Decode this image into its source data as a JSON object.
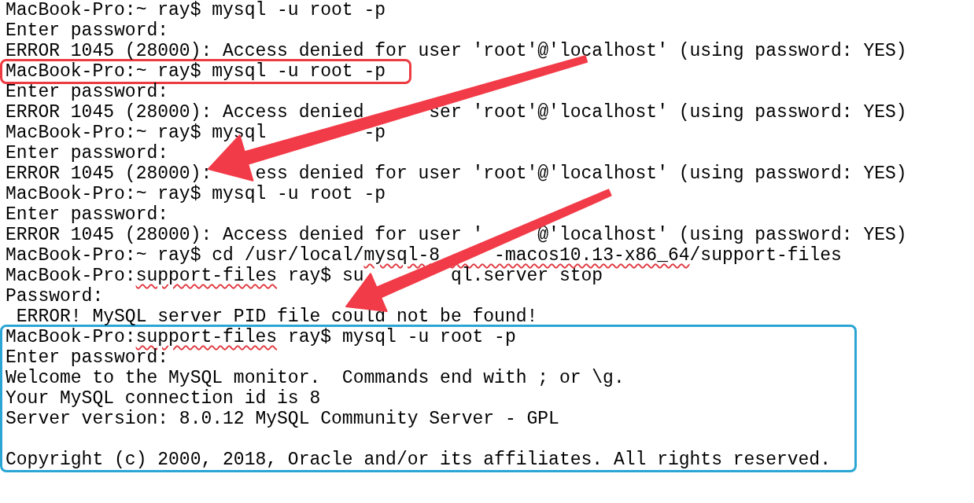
{
  "blocks": [
    {
      "framed": false,
      "lines": [
        {
          "kind": "text",
          "segments": [
            {
              "text": "MacBook-Pro:~ ray$ mysql -u root -p",
              "misspelled": false
            }
          ]
        },
        {
          "kind": "text",
          "segments": [
            {
              "text": "Enter password:",
              "misspelled": false
            }
          ]
        },
        {
          "kind": "text",
          "segments": [
            {
              "text": "ERROR 1045 (28000): Access denied for user 'root'@'localhost' (using password: YES)",
              "misspelled": false
            }
          ]
        }
      ]
    },
    {
      "framed": true,
      "color": "#ec3b41",
      "lines": [
        {
          "kind": "text",
          "segments": [
            {
              "text": "MacBook-Pro:~ ray$ mysql -u root -p",
              "misspelled": false
            }
          ]
        }
      ]
    },
    {
      "framed": false,
      "lines": [
        {
          "kind": "text",
          "segments": [
            {
              "text": "Enter password:",
              "misspelled": false
            }
          ]
        },
        {
          "kind": "text",
          "segments": [
            {
              "text": "ERROR 1045 (28000): Access denied      ser 'root'@'localhost' (using password: YES)",
              "misspelled": false
            }
          ]
        },
        {
          "kind": "text",
          "segments": [
            {
              "text": "MacBook-Pro:~ ray$ mysql         -p",
              "misspelled": false
            }
          ]
        },
        {
          "kind": "text",
          "segments": [
            {
              "text": "Enter password:",
              "misspelled": false
            }
          ]
        },
        {
          "kind": "text",
          "segments": [
            {
              "text": "ERROR 1045 (28000):    ess denied for user 'root'@'localhost' (using password: YES)",
              "misspelled": false
            }
          ]
        },
        {
          "kind": "text",
          "segments": [
            {
              "text": "MacBook-Pro:~ ray$ mysql -u root -p",
              "misspelled": false
            }
          ]
        },
        {
          "kind": "text",
          "segments": [
            {
              "text": "Enter password:",
              "misspelled": false
            }
          ]
        },
        {
          "kind": "text",
          "segments": [
            {
              "text": "ERROR 1045 (28000): Access denied for user '     @'localhost' (using password: YES)",
              "misspelled": false
            }
          ]
        },
        {
          "kind": "text",
          "segments": [
            {
              "text": "MacBook-Pro:~ ray$ cd /usr/local/",
              "misspelled": false
            },
            {
              "text": "mysql-8     -macos10.13-x86_64",
              "misspelled": true
            },
            {
              "text": "/support-files",
              "misspelled": false
            }
          ]
        },
        {
          "kind": "text",
          "segments": [
            {
              "text": "MacBook-Pro:",
              "misspelled": false
            },
            {
              "text": "support-files",
              "misspelled": true
            },
            {
              "text": " ray$ su        ql.server stop",
              "misspelled": false
            }
          ]
        },
        {
          "kind": "text",
          "segments": [
            {
              "text": "Password:",
              "misspelled": false
            }
          ]
        },
        {
          "kind": "text",
          "segments": [
            {
              "text": " ERROR! MySQL server PID file could not be found!",
              "misspelled": false
            }
          ]
        }
      ]
    },
    {
      "framed": true,
      "color": "#2ba6d4",
      "lines": [
        {
          "kind": "text",
          "segments": [
            {
              "text": "MacBook-Pro:",
              "misspelled": false
            },
            {
              "text": "support-files",
              "misspelled": true
            },
            {
              "text": " ray$ mysql -u root -p",
              "misspelled": false
            }
          ]
        },
        {
          "kind": "text",
          "segments": [
            {
              "text": "Enter password:",
              "misspelled": false
            }
          ]
        },
        {
          "kind": "text",
          "segments": [
            {
              "text": "Welcome to the MySQL monitor.  Commands end with ; or \\g.",
              "misspelled": false
            }
          ]
        },
        {
          "kind": "text",
          "segments": [
            {
              "text": "Your MySQL connection id is 8",
              "misspelled": false
            }
          ]
        },
        {
          "kind": "text",
          "segments": [
            {
              "text": "Server version: 8.0.12 MySQL Community Server - GPL",
              "misspelled": false
            }
          ]
        },
        {
          "kind": "blank"
        },
        {
          "kind": "text",
          "segments": [
            {
              "text": "Copyright (c) 2000, 2018, Oracle and/or its affiliates. All rights reserved.",
              "misspelled": false
            }
          ]
        }
      ]
    }
  ]
}
